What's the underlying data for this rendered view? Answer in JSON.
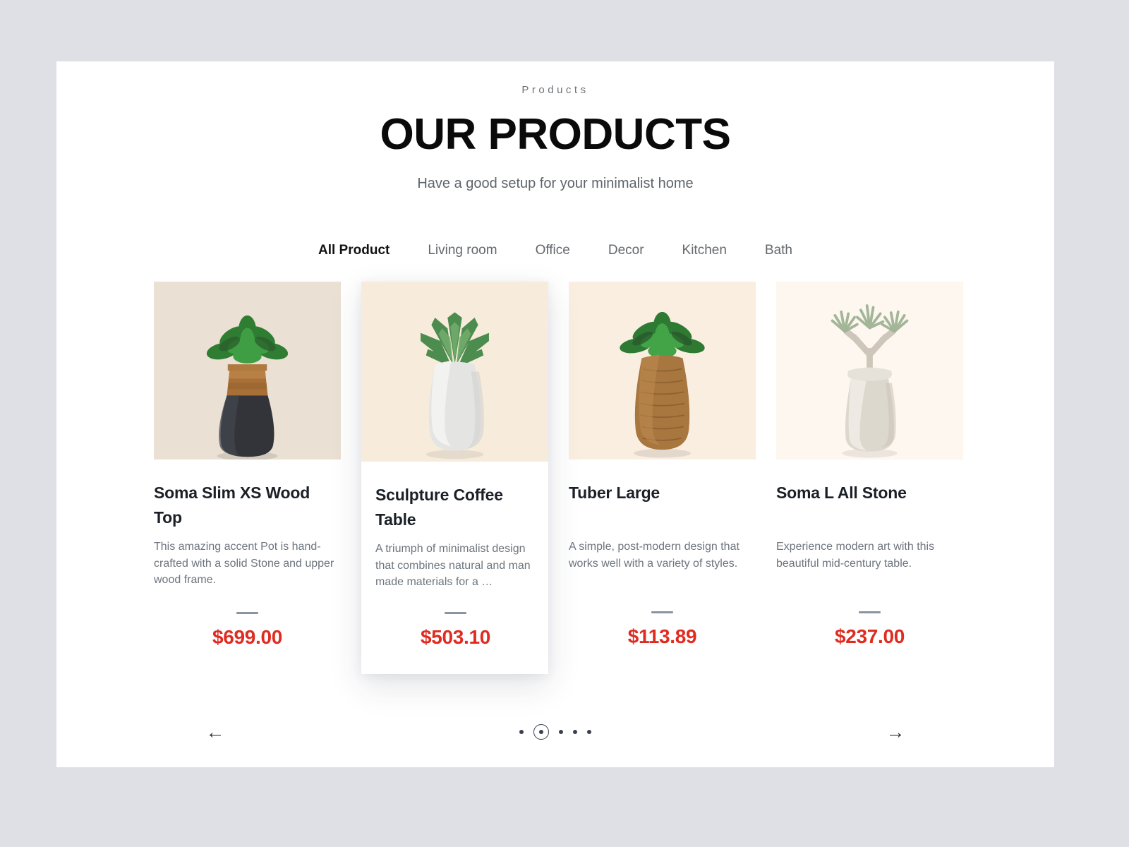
{
  "header": {
    "eyebrow": "Products",
    "title": "OUR PRODUCTS",
    "subtitle": "Have a good setup for your minimalist home"
  },
  "filters": {
    "items": [
      {
        "label": "All Product",
        "active": true
      },
      {
        "label": "Living room",
        "active": false
      },
      {
        "label": "Office",
        "active": false
      },
      {
        "label": "Decor",
        "active": false
      },
      {
        "label": "Kitchen",
        "active": false
      },
      {
        "label": "Bath",
        "active": false
      }
    ]
  },
  "products": [
    {
      "name": "Soma Slim XS Wood Top",
      "description": "This amazing accent Pot is hand-crafted with a solid Stone and upper wood frame.",
      "price": "$699.00",
      "tile_bg": "#eae0d3",
      "featured": false,
      "image_name": "dark-charcoal-pot-with-wood-collar-and-leafy-plant"
    },
    {
      "name": "Sculpture Coffee Table",
      "description": "A triumph of minimalist design that combines natural and man made materials for a …",
      "price": "$503.10",
      "tile_bg": "#f7ecdc",
      "featured": true,
      "image_name": "white-tapered-vase-with-agave-succulent"
    },
    {
      "name": "Tuber Large",
      "description": "A simple, post-modern design that works well with a variety of styles.",
      "price": "$113.89",
      "tile_bg": "#f9eee0",
      "featured": false,
      "image_name": "wooden-slatted-tapered-pot-with-leafy-plant"
    },
    {
      "name": "Soma L All Stone",
      "description": "Experience modern art with this beautiful mid-century table.",
      "price": "$237.00",
      "tile_bg": "#fdf7ef",
      "featured": false,
      "image_name": "pale-stone-vase-with-branching-succulent-tree"
    }
  ],
  "carousel": {
    "prev_label": "←",
    "next_label": "→",
    "dot_count": 5,
    "active_dot_index": 1
  },
  "colors": {
    "page_bg": "#dee0e6",
    "panel_bg": "#ffffff",
    "price": "#e02b20",
    "title": "#0a0a0a",
    "muted_text": "#6d757e",
    "divider": "#8b95a1"
  }
}
